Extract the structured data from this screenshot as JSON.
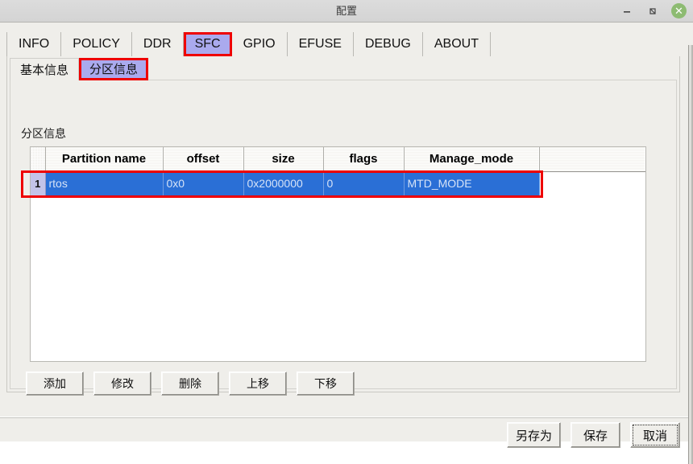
{
  "window": {
    "title": "配置",
    "controls": {
      "minimize": "minimize-icon",
      "restore": "restore-icon",
      "close": "✕"
    }
  },
  "tabs": {
    "selected": "SFC",
    "items": [
      {
        "label": "INFO"
      },
      {
        "label": "POLICY"
      },
      {
        "label": "DDR"
      },
      {
        "label": "SFC"
      },
      {
        "label": "GPIO"
      },
      {
        "label": "EFUSE"
      },
      {
        "label": "DEBUG"
      },
      {
        "label": "ABOUT"
      }
    ]
  },
  "subtabs": {
    "selected": "分区信息",
    "items": [
      {
        "label": "基本信息"
      },
      {
        "label": "分区信息"
      }
    ]
  },
  "panel": {
    "group_label": "分区信息"
  },
  "table": {
    "columns": [
      "",
      "Partition name",
      "offset",
      "size",
      "flags",
      "Manage_mode",
      ""
    ],
    "rows": [
      {
        "index": "1",
        "selected": true,
        "partition_name": "rtos",
        "offset": "0x0",
        "size": "0x2000000",
        "flags": "0",
        "manage_mode": "MTD_MODE"
      }
    ]
  },
  "actions": {
    "add": "添加",
    "modify": "修改",
    "delete": "删除",
    "move_up": "上移",
    "move_down": "下移"
  },
  "footer": {
    "save_as": "另存为",
    "save": "保存",
    "cancel": "取消"
  },
  "colors": {
    "accent_selection": "#2a6fd6",
    "highlight_border": "#ee0000",
    "tab_selected_bg": "#aaaaee",
    "window_bg": "#efeeea",
    "close_button": "#8dbb72"
  }
}
